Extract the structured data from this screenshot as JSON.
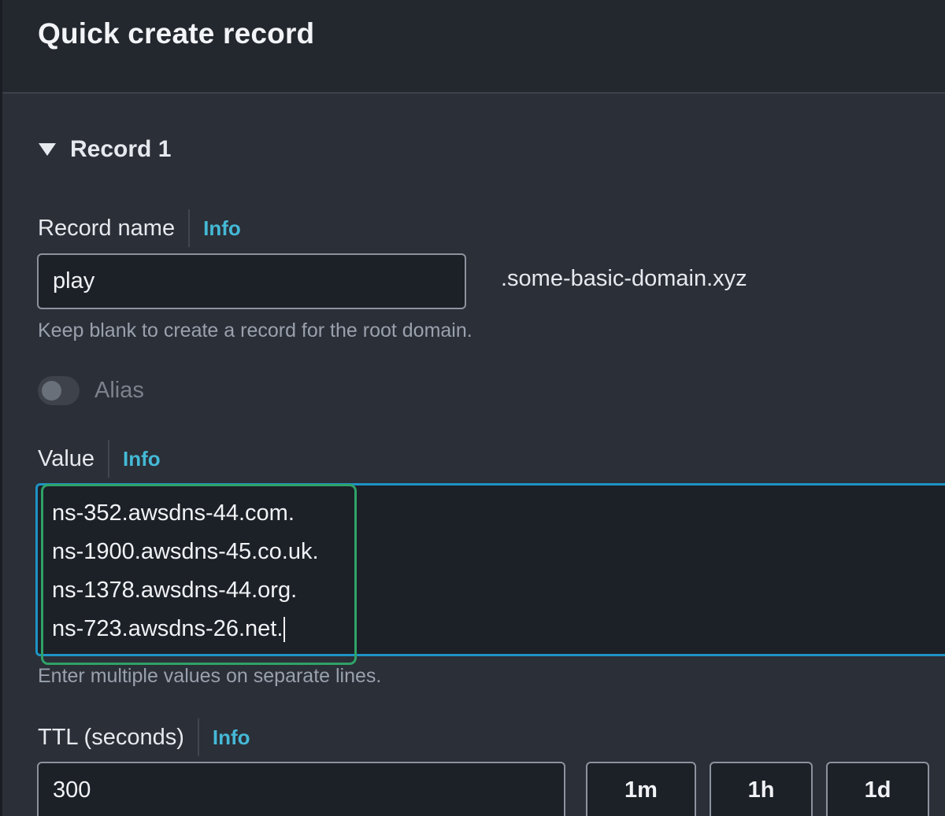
{
  "header": {
    "title": "Quick create record"
  },
  "section": {
    "title": "Record 1",
    "icon": "triangle-down-icon"
  },
  "record_name": {
    "label": "Record name",
    "info": "Info",
    "value": "play",
    "suffix": ".some-basic-domain.xyz",
    "hint": "Keep blank to create a record for the root domain."
  },
  "alias": {
    "label": "Alias",
    "enabled": false
  },
  "value_field": {
    "label": "Value",
    "info": "Info",
    "lines": [
      "ns-352.awsdns-44.com.",
      "ns-1900.awsdns-45.co.uk.",
      "ns-1378.awsdns-44.org.",
      "ns-723.awsdns-26.net."
    ],
    "hint": "Enter multiple values on separate lines."
  },
  "ttl": {
    "label": "TTL (seconds)",
    "info": "Info",
    "value": "300",
    "presets": [
      "1m",
      "1h",
      "1d"
    ]
  },
  "colors": {
    "background": "#2b2f37",
    "input_bg": "#1c2027",
    "info_link": "#44b9d6",
    "focus_border": "#1f93c4",
    "highlight_border": "#2fa267"
  }
}
